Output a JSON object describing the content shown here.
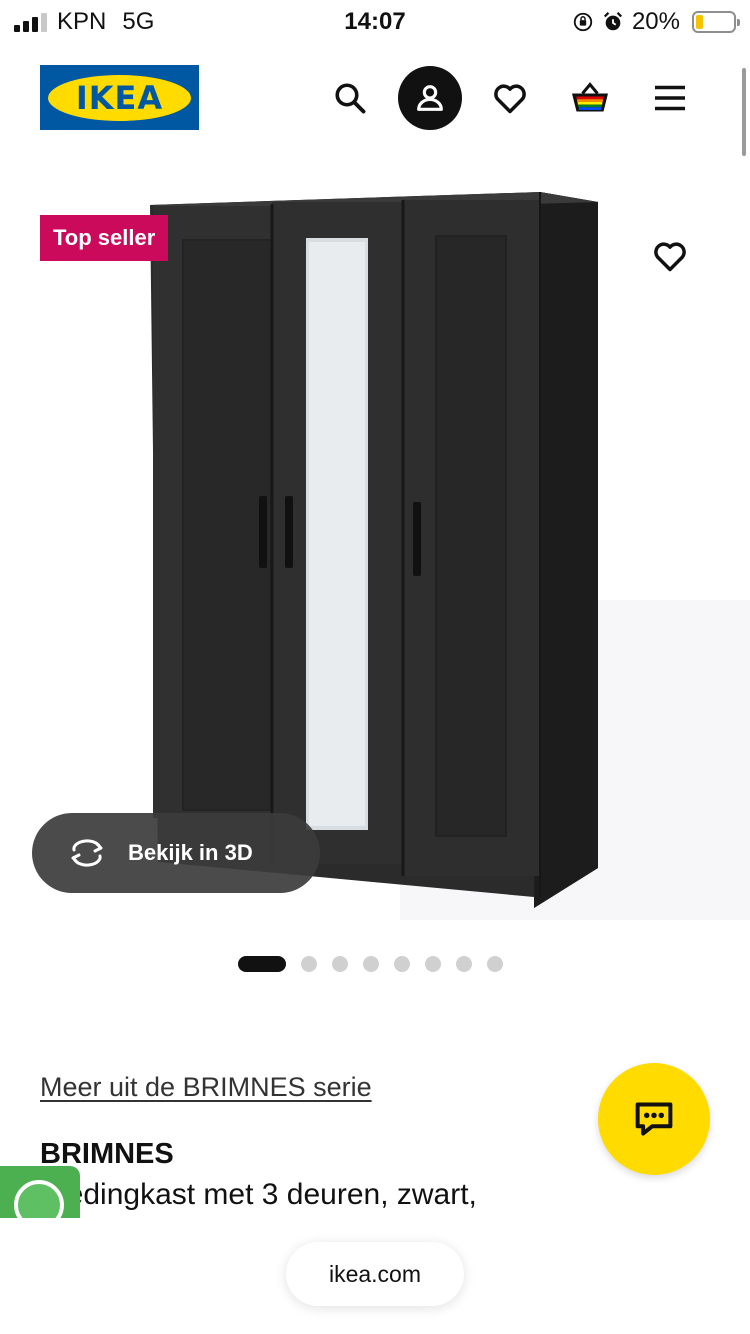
{
  "status_bar": {
    "carrier": "KPN",
    "network": "5G",
    "time": "14:07",
    "battery_percent": "20%",
    "battery_level": 0.2,
    "icons": [
      "signal-icon",
      "orientation-lock-icon",
      "alarm-icon",
      "battery-icon"
    ]
  },
  "header": {
    "logo_text": "IKEA",
    "icons": [
      "search-icon",
      "profile-icon",
      "heart-icon",
      "basket-icon",
      "menu-icon"
    ]
  },
  "product_image": {
    "badge": "Top seller",
    "view_3d_label": "Bekijk in 3D",
    "favorite_icon": "heart-icon",
    "carousel": {
      "total": 8,
      "active": 1
    }
  },
  "product": {
    "series_link": "Meer uit de BRIMNES serie",
    "name": "BRIMNES",
    "description": "Kledingkast met 3 deuren, zwart,"
  },
  "footer": {
    "url": "ikea.com",
    "chat_icon": "chat-icon"
  },
  "colors": {
    "ikea_blue": "#0058a3",
    "ikea_yellow": "#ffdb00",
    "badge_pink": "#cc0a5c"
  }
}
